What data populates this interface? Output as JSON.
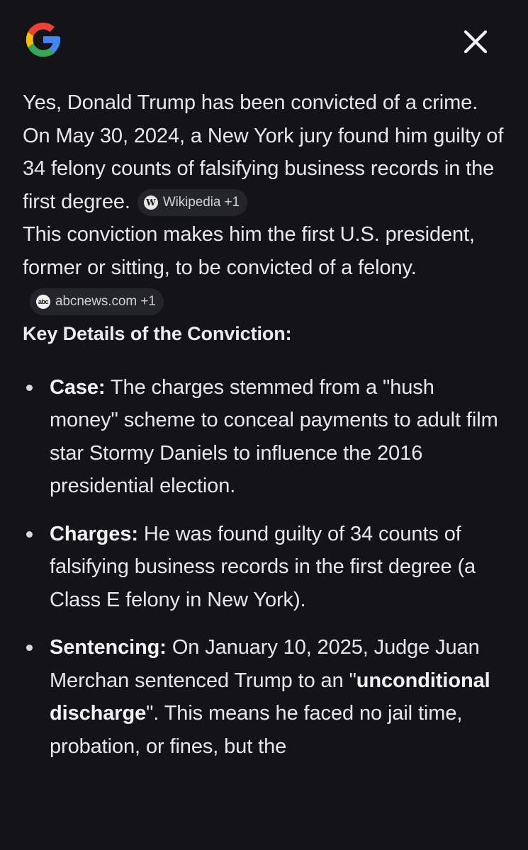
{
  "header": {
    "logo": "google-g-logo",
    "close_icon": "close-icon"
  },
  "para1": {
    "text": "Yes, Donald Trump has been convicted of a crime. On May 30, 2024, a New York jury found him guilty of 34 felony counts of falsifying business records in the first degree.",
    "chip_label": "Wikipedia +1",
    "chip_icon": "W"
  },
  "para2": {
    "text": "This conviction makes him the first U.S. president, former or sitting, to be convicted of a felony.",
    "chip_label": "abcnews.com +1",
    "chip_icon": "abc"
  },
  "heading": "Key Details of the Conviction:",
  "details": [
    {
      "label": "Case:",
      "text": " The charges stemmed from a \"hush money\" scheme to conceal payments to adult film star Stormy Daniels to influence the 2016 presidential election."
    },
    {
      "label": "Charges:",
      "text": " He was found guilty of 34 counts of falsifying business records in the first degree (a Class E felony in New York)."
    },
    {
      "label": "Sentencing:",
      "text_before": " On January 10, 2025, Judge Juan Merchan sentenced Trump to an \"",
      "emphasis": "unconditional discharge",
      "text_after": "\". This means he faced no jail time, probation, or fines, but the"
    }
  ],
  "colors": {
    "background": "#131318",
    "text": "#e8e8ec",
    "chip_bg": "#24242b",
    "google_blue": "#4285F4",
    "google_red": "#EA4335",
    "google_yellow": "#FBBC05",
    "google_green": "#34A853"
  }
}
